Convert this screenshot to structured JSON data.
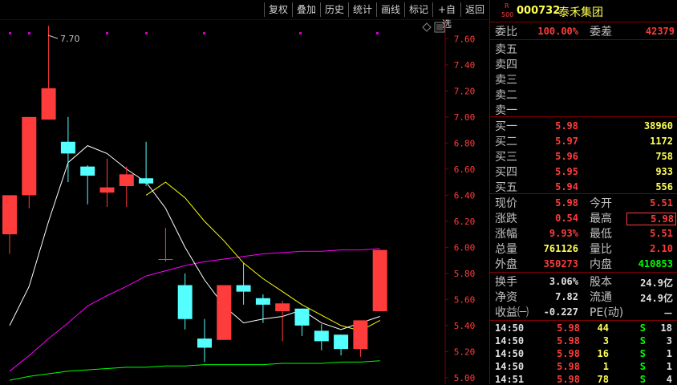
{
  "toolbar": {
    "buttons": [
      "复权",
      "叠加",
      "历史",
      "统计",
      "画线",
      "标记",
      "+自选",
      "返回"
    ]
  },
  "stock": {
    "badge_top": "R",
    "badge_bottom": "500",
    "code": "000732",
    "name": "泰禾集团"
  },
  "order_ratio": {
    "label1": "委比",
    "value1": "100.00%",
    "label2": "委差",
    "value2": "42379"
  },
  "asks": [
    {
      "label": "卖五",
      "price": "",
      "volume": ""
    },
    {
      "label": "卖四",
      "price": "",
      "volume": ""
    },
    {
      "label": "卖三",
      "price": "",
      "volume": ""
    },
    {
      "label": "卖二",
      "price": "",
      "volume": ""
    },
    {
      "label": "卖一",
      "price": "",
      "volume": ""
    }
  ],
  "bids": [
    {
      "label": "买一",
      "price": "5.98",
      "volume": "38960"
    },
    {
      "label": "买二",
      "price": "5.97",
      "volume": "1172"
    },
    {
      "label": "买三",
      "price": "5.96",
      "volume": "758"
    },
    {
      "label": "买四",
      "price": "5.95",
      "volume": "933"
    },
    {
      "label": "买五",
      "price": "5.94",
      "volume": "556"
    }
  ],
  "quote": [
    {
      "l1": "现价",
      "v1": "5.98",
      "c1": "red",
      "l2": "今开",
      "v2": "5.51",
      "c2": "red"
    },
    {
      "l1": "涨跌",
      "v1": "0.54",
      "c1": "red",
      "l2": "最高",
      "v2": "5.98",
      "c2": "red"
    },
    {
      "l1": "涨幅",
      "v1": "9.93%",
      "c1": "red",
      "l2": "最低",
      "v2": "5.51",
      "c2": "red"
    },
    {
      "l1": "总量",
      "v1": "761126",
      "c1": "yel",
      "l2": "量比",
      "v2": "2.10",
      "c2": "red"
    },
    {
      "l1": "外盘",
      "v1": "350273",
      "c1": "red",
      "l2": "内盘",
      "v2": "410853",
      "c2": "grn"
    }
  ],
  "fundamentals": [
    {
      "l1": "换手",
      "v1": "3.06%",
      "l2": "股本",
      "v2": "24.9亿"
    },
    {
      "l1": "净资",
      "v1": "7.82",
      "l2": "流通",
      "v2": "24.9亿"
    },
    {
      "l1": "收益㈠",
      "v1": "-0.227",
      "l2": "PE(动)",
      "v2": "－"
    }
  ],
  "ticks": [
    {
      "time": "14:50",
      "price": "5.98",
      "vol": "44",
      "side": "S",
      "count": "18"
    },
    {
      "time": "14:50",
      "price": "5.98",
      "vol": "3",
      "side": "S",
      "count": "3"
    },
    {
      "time": "14:50",
      "price": "5.98",
      "vol": "16",
      "side": "S",
      "count": "1"
    },
    {
      "time": "14:50",
      "price": "5.98",
      "vol": "1",
      "side": "S",
      "count": "1"
    },
    {
      "time": "14:51",
      "price": "5.98",
      "vol": "78",
      "side": "S",
      "count": "4"
    }
  ],
  "colors": {
    "up": "#ff3c3c",
    "down": "#54ffff",
    "ma5": "#ffffff",
    "ma10": "#ffff00",
    "ma20": "#ff00ff",
    "ma60": "#00ff00",
    "grid": "#800000"
  },
  "chart_data": {
    "type": "candlestick",
    "y_ticks": [
      "7.60",
      "7.40",
      "7.20",
      "7.00",
      "6.80",
      "6.60",
      "6.40",
      "6.20",
      "6.00",
      "5.80",
      "5.60",
      "5.40",
      "5.20",
      "5.00"
    ],
    "ylim": [
      4.95,
      7.75
    ],
    "annotation": "7.70",
    "candles": [
      {
        "o": 6.1,
        "c": 6.4,
        "h": 6.4,
        "l": 5.95
      },
      {
        "o": 6.4,
        "c": 7.0,
        "h": 7.0,
        "l": 6.3
      },
      {
        "o": 6.98,
        "c": 7.22,
        "h": 7.7,
        "l": 6.98
      },
      {
        "o": 6.81,
        "c": 6.72,
        "h": 7.0,
        "l": 6.5
      },
      {
        "o": 6.62,
        "c": 6.55,
        "h": 6.63,
        "l": 6.33
      },
      {
        "o": 6.42,
        "c": 6.46,
        "h": 6.68,
        "l": 6.31
      },
      {
        "o": 6.47,
        "c": 6.56,
        "h": 6.62,
        "l": 6.31
      },
      {
        "o": 6.53,
        "c": 6.49,
        "h": 6.81,
        "l": 6.47
      },
      {
        "o": 5.91,
        "c": 5.91,
        "h": 6.15,
        "l": 5.89
      },
      {
        "o": 5.71,
        "c": 5.45,
        "h": 5.8,
        "l": 5.37
      },
      {
        "o": 5.3,
        "c": 5.23,
        "h": 5.45,
        "l": 5.12
      },
      {
        "o": 5.29,
        "c": 5.71,
        "h": 5.71,
        "l": 5.29
      },
      {
        "o": 5.71,
        "c": 5.66,
        "h": 5.88,
        "l": 5.56
      },
      {
        "o": 5.61,
        "c": 5.56,
        "h": 5.64,
        "l": 5.42
      },
      {
        "o": 5.51,
        "c": 5.57,
        "h": 5.59,
        "l": 5.28
      },
      {
        "o": 5.53,
        "c": 5.4,
        "h": 5.53,
        "l": 5.32
      },
      {
        "o": 5.36,
        "c": 5.28,
        "h": 5.41,
        "l": 5.21
      },
      {
        "o": 5.33,
        "c": 5.22,
        "h": 5.33,
        "l": 5.17
      },
      {
        "o": 5.22,
        "c": 5.44,
        "h": 5.44,
        "l": 5.16
      },
      {
        "o": 5.51,
        "c": 5.98,
        "h": 5.98,
        "l": 5.51
      }
    ],
    "ma5": [
      5.4,
      5.7,
      6.2,
      6.65,
      6.78,
      6.72,
      6.6,
      6.5,
      6.3,
      6.0,
      5.75,
      5.55,
      5.42,
      5.45,
      5.47,
      5.52,
      5.42,
      5.37,
      5.42,
      5.47
    ],
    "ma10": [
      null,
      null,
      null,
      null,
      null,
      null,
      null,
      6.4,
      6.5,
      6.38,
      6.2,
      6.05,
      5.88,
      5.76,
      5.66,
      5.56,
      5.48,
      5.4,
      5.36,
      5.44
    ],
    "ma20": [
      5.05,
      5.17,
      5.3,
      5.42,
      5.55,
      5.63,
      5.7,
      5.78,
      5.82,
      5.86,
      5.89,
      5.91,
      5.93,
      5.95,
      5.96,
      5.97,
      5.97,
      5.98,
      5.98,
      5.99
    ],
    "ma60": [
      4.98,
      5.01,
      5.03,
      5.05,
      5.06,
      5.07,
      5.08,
      5.08,
      5.09,
      5.09,
      5.1,
      5.1,
      5.1,
      5.1,
      5.11,
      5.11,
      5.11,
      5.12,
      5.12,
      5.13
    ]
  }
}
